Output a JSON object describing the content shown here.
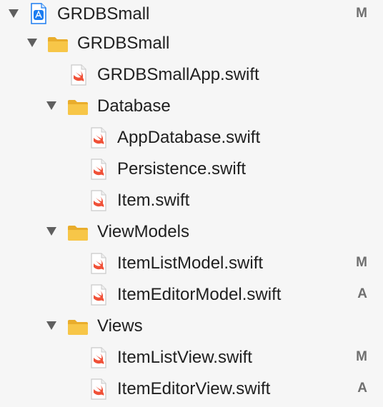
{
  "tree": {
    "project": {
      "label": "GRDBSmall",
      "status": "M"
    },
    "group": {
      "label": "GRDBSmall"
    },
    "app_file": {
      "label": "GRDBSmallApp.swift"
    },
    "database": {
      "label": "Database",
      "files": [
        {
          "label": "AppDatabase.swift"
        },
        {
          "label": "Persistence.swift"
        },
        {
          "label": "Item.swift"
        }
      ]
    },
    "viewmodels": {
      "label": "ViewModels",
      "files": [
        {
          "label": "ItemListModel.swift",
          "status": "M"
        },
        {
          "label": "ItemEditorModel.swift",
          "status": "A"
        }
      ]
    },
    "views": {
      "label": "Views",
      "files": [
        {
          "label": "ItemListView.swift",
          "status": "M"
        },
        {
          "label": "ItemEditorView.swift",
          "status": "A"
        }
      ]
    }
  },
  "colors": {
    "background": "#f6f6f6",
    "folder": "#f5c242",
    "project_icon": "#1a7cf0",
    "swift": "#f05138",
    "status_text": "#6f6f6f",
    "disclosure": "#5f5f5f"
  },
  "icons": {
    "disclosure": "disclosure-triangle-icon",
    "project": "xcode-project-icon",
    "folder": "folder-icon",
    "swift_file": "swift-file-icon"
  }
}
